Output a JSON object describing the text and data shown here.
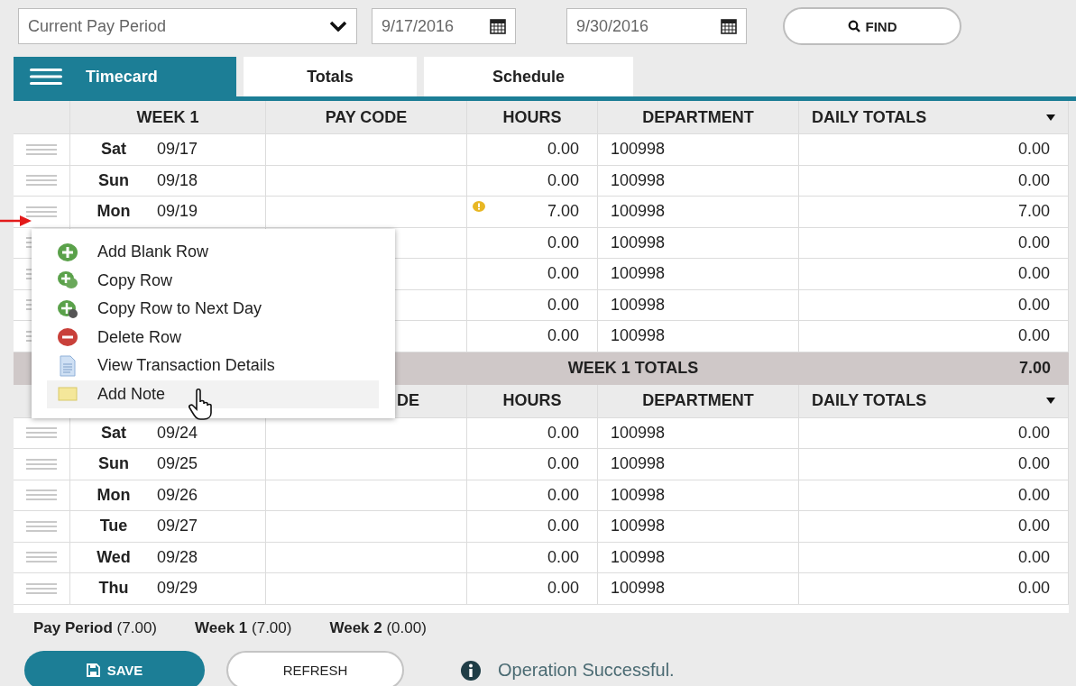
{
  "filters": {
    "period": {
      "value": "Current Pay Period"
    },
    "start_date": {
      "value": "9/17/2016"
    },
    "end_date": {
      "value": "9/30/2016"
    },
    "find_button": "FIND"
  },
  "tabs": [
    {
      "label": "Timecard",
      "selected": true
    },
    {
      "label": "Totals",
      "selected": false
    },
    {
      "label": "Schedule",
      "selected": false
    }
  ],
  "weeks": [
    {
      "header": {
        "week": "WEEK 1",
        "pay_code": "PAY CODE",
        "hours": "HOURS",
        "department": "DEPARTMENT",
        "daily_totals": "DAILY TOTALS"
      },
      "rows": [
        {
          "day": "Sat",
          "date": "09/17",
          "hours": "0.00",
          "department": "100998",
          "daily_total": "0.00",
          "warning": false
        },
        {
          "day": "Sun",
          "date": "09/18",
          "hours": "0.00",
          "department": "100998",
          "daily_total": "0.00",
          "warning": false
        },
        {
          "day": "Mon",
          "date": "09/19",
          "hours": "7.00",
          "department": "100998",
          "daily_total": "7.00",
          "warning": true
        },
        {
          "hours": "0.00",
          "department": "100998",
          "daily_total": "0.00",
          "warning": false
        },
        {
          "hours": "0.00",
          "department": "100998",
          "daily_total": "0.00",
          "warning": false
        },
        {
          "hours": "0.00",
          "department": "100998",
          "daily_total": "0.00",
          "warning": false
        },
        {
          "hours": "0.00",
          "department": "100998",
          "daily_total": "0.00",
          "warning": false
        }
      ],
      "totals": {
        "label": "WEEK 1 TOTALS",
        "value": "7.00"
      }
    },
    {
      "header": {
        "pay_code": "DE",
        "hours": "HOURS",
        "department": "DEPARTMENT",
        "daily_totals": "DAILY TOTALS"
      },
      "rows": [
        {
          "day": "Sat",
          "date": "09/24",
          "hours": "0.00",
          "department": "100998",
          "daily_total": "0.00",
          "warning": false
        },
        {
          "day": "Sun",
          "date": "09/25",
          "hours": "0.00",
          "department": "100998",
          "daily_total": "0.00",
          "warning": false
        },
        {
          "day": "Mon",
          "date": "09/26",
          "hours": "0.00",
          "department": "100998",
          "daily_total": "0.00",
          "warning": false
        },
        {
          "day": "Tue",
          "date": "09/27",
          "hours": "0.00",
          "department": "100998",
          "daily_total": "0.00",
          "warning": false
        },
        {
          "day": "Wed",
          "date": "09/28",
          "hours": "0.00",
          "department": "100998",
          "daily_total": "0.00",
          "warning": false
        },
        {
          "day": "Thu",
          "date": "09/29",
          "hours": "0.00",
          "department": "100998",
          "daily_total": "0.00",
          "warning": false
        }
      ]
    }
  ],
  "context_menu": {
    "items": [
      {
        "kind": "add",
        "label": "Add Blank Row",
        "selected": false
      },
      {
        "kind": "copy",
        "label": "Copy Row",
        "selected": false
      },
      {
        "kind": "copy_next",
        "label": "Copy Row to Next Day",
        "selected": false
      },
      {
        "kind": "delete",
        "label": "Delete Row",
        "selected": false
      },
      {
        "kind": "details",
        "label": "View Transaction Details",
        "selected": false
      },
      {
        "kind": "note",
        "label": "Add Note",
        "selected": true
      }
    ]
  },
  "summary": [
    "**Pay Period** (7.00)",
    "**Week 1** (7.00)",
    "**Week 2** (0.00)"
  ],
  "buttons": {
    "save": "SAVE",
    "refresh": "REFRESH"
  },
  "status": {
    "message": "Operation Successful."
  }
}
